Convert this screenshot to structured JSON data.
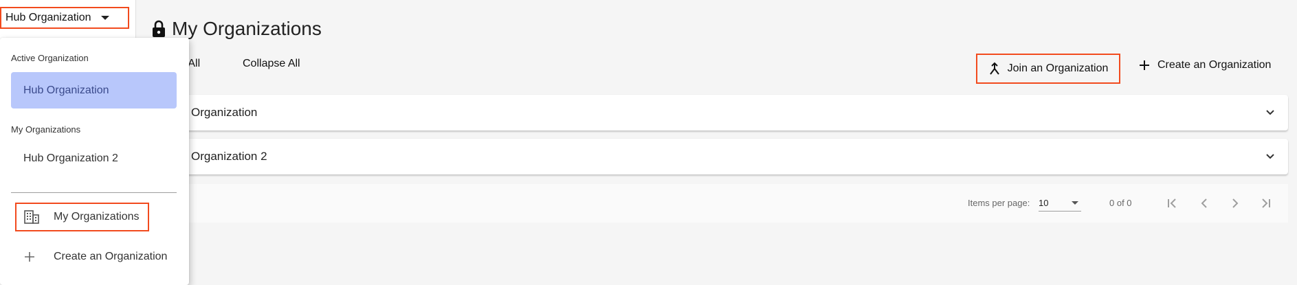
{
  "org_selector": {
    "label": "Hub Organization"
  },
  "page": {
    "title": "My Organizations"
  },
  "toolbar": {
    "expand_all": "nd All",
    "collapse_all": "Collapse All",
    "join": "Join an Organization",
    "create": "Create an Organization"
  },
  "panels": [
    {
      "title": "Organization"
    },
    {
      "title": "Organization 2"
    }
  ],
  "paginator": {
    "items_per_page_label": "Items per page:",
    "items_per_page_value": "10",
    "range": "0 of 0"
  },
  "dropdown": {
    "active_label": "Active Organization",
    "active_org": "Hub Organization",
    "my_orgs_label": "My Organizations",
    "my_orgs": [
      "Hub Organization 2"
    ],
    "my_organizations_link": "My Organizations",
    "create_link": "Create an Organization"
  },
  "colors": {
    "highlight_border": "#f24a1d",
    "active_org_bg": "#b8c7fb",
    "active_org_text": "#3a4a8c",
    "background": "#f5f5f5"
  },
  "icons": {
    "org_selector": "caret-down-icon",
    "title": "lock-icon",
    "join": "merge-icon",
    "create": "plus-icon",
    "panel": "chevron-down-icon",
    "my_organizations_link": "building-icon",
    "create_link": "plus-icon",
    "pagination": [
      "first-page-icon",
      "prev-page-icon",
      "next-page-icon",
      "last-page-icon"
    ]
  }
}
